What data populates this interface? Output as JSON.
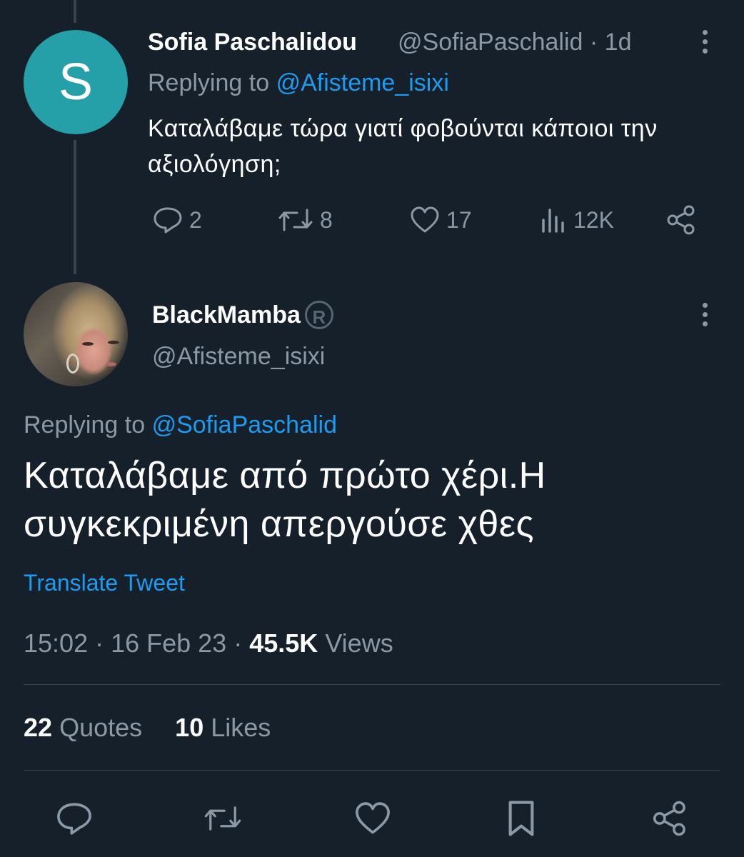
{
  "reply_tweet": {
    "avatar_letter": "S",
    "author_name": "Sofia Paschalidou",
    "author_handle": "@SofiaPaschalid",
    "time_ago": "· 1d",
    "replying_prefix": "Replying to",
    "replying_handle": "@Afisteme_isixi",
    "text": "Καταλάβαμε τώρα γιατί φοβούνται κάποιοι την αξιολόγηση;",
    "actions": {
      "replies": "2",
      "retweets": "8",
      "likes": "17",
      "views": "12K"
    }
  },
  "main_tweet": {
    "author_name": "BlackMamba",
    "badge_symbol": "R",
    "author_handle": "@Afisteme_isixi",
    "replying_prefix": "Replying to",
    "replying_handle": "@SofiaPaschalid",
    "text": "Καταλάβαμε από πρώτο χέρι.Η συγκεκριμένη απεργούσε χθες",
    "translate_label": "Translate Tweet",
    "timestamp": "15:02 · 16 Feb 23 ·",
    "views_count": "45.5K",
    "views_label": "Views",
    "quotes_count": "22",
    "quotes_label": "Quotes",
    "likes_count": "10",
    "likes_label": "Likes"
  },
  "colors": {
    "background": "#15202b",
    "link": "#1d9bf0",
    "muted": "#8b98a5",
    "divider": "#38444d",
    "avatar_bg": "#26a0a8"
  },
  "icons": [
    "reply-icon",
    "retweet-icon",
    "like-icon",
    "views-icon",
    "share-icon",
    "bookmark-icon",
    "more-icon"
  ]
}
